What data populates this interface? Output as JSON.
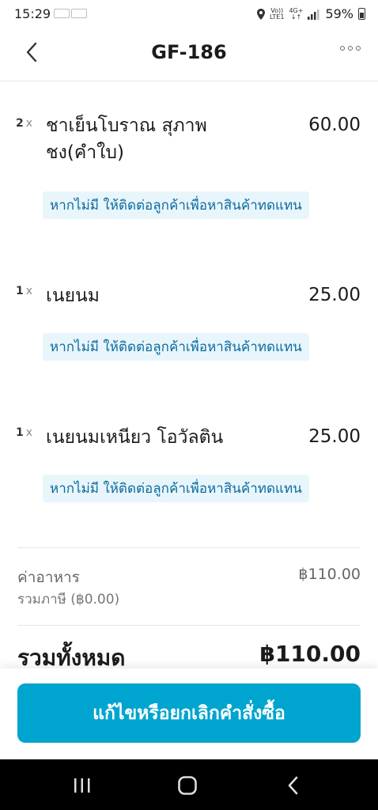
{
  "status_bar": {
    "time": "15:29",
    "battery": "59%",
    "network_top": "4G+",
    "network_left": "Vo))",
    "network_left2": "LTE1",
    "icons": [
      "location-icon",
      "signal-icon",
      "battery-icon"
    ]
  },
  "header": {
    "title": "GF-186",
    "back_icon": "chevron-left-icon",
    "more_icon": "more-dots-icon"
  },
  "items": [
    {
      "qty": "2",
      "x": "x",
      "name": "ชาเย็นโบราณ สุภาพชง(คำใบ)",
      "price": "60.00",
      "note": "หากไม่มี ให้ติดต่อลูกค้าเพื่อหาสินค้าทดแทน"
    },
    {
      "qty": "1",
      "x": "x",
      "name": "เนยนม",
      "price": "25.00",
      "note": "หากไม่มี ให้ติดต่อลูกค้าเพื่อหาสินค้าทดแทน"
    },
    {
      "qty": "1",
      "x": "x",
      "name": "เนยนมเหนียว โอวัลติน",
      "price": "25.00",
      "note": "หากไม่มี ให้ติดต่อลูกค้าเพื่อหาสินค้าทดแทน"
    }
  ],
  "summary": {
    "food_label": "ค่าอาหาร",
    "tax_label": "รวมภาษี (฿0.00)",
    "food_value": "฿110.00",
    "total_label": "รวมทั้งหมด",
    "total_value": "฿110.00"
  },
  "action": {
    "primary_label": "แก้ไขหรือยกเลิกคำสั่งซื้อ"
  },
  "colors": {
    "accent": "#00a5cf",
    "note_bg": "#e8f6fc",
    "note_text": "#0b6a9e"
  },
  "nav": {
    "icons": [
      "recent-apps-icon",
      "home-icon",
      "back-icon"
    ]
  }
}
